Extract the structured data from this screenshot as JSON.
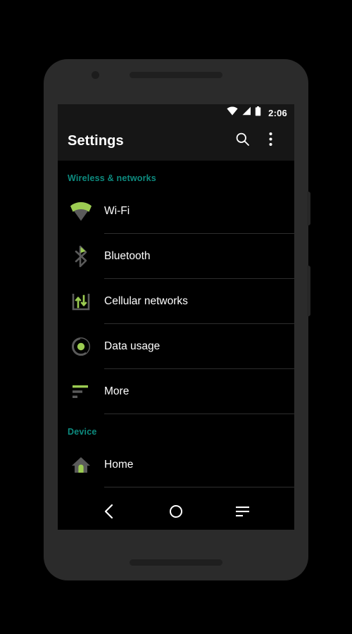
{
  "device": {
    "frame_name": "android-phone-frame",
    "earpiece": "earpiece-speaker",
    "camera": "front-camera"
  },
  "status_bar": {
    "time": "2:06",
    "icons": [
      "wifi-icon",
      "cellular-signal-icon",
      "battery-icon"
    ]
  },
  "app_bar": {
    "title": "Settings",
    "search_icon": "search-icon",
    "overflow_icon": "overflow-menu-icon"
  },
  "colors": {
    "accent_teal": "#0d8b7f",
    "icon_green": "#9ccc52",
    "icon_gray": "#5a5a5a",
    "app_bar_bg": "#161616",
    "screen_bg": "#000000",
    "text_primary": "#ffffff",
    "divider": "#2e2e2e"
  },
  "sections": [
    {
      "header": "Wireless & networks",
      "items": [
        {
          "label": "Wi-Fi",
          "icon": "wifi-icon"
        },
        {
          "label": "Bluetooth",
          "icon": "bluetooth-icon"
        },
        {
          "label": "Cellular networks",
          "icon": "cellular-networks-icon"
        },
        {
          "label": "Data usage",
          "icon": "data-usage-icon"
        },
        {
          "label": "More",
          "icon": "more-settings-icon"
        }
      ]
    },
    {
      "header": "Device",
      "items": [
        {
          "label": "Home",
          "icon": "home-icon"
        }
      ]
    }
  ],
  "nav_bar": {
    "back": "back-button",
    "home": "home-button",
    "recents": "recents-button"
  }
}
